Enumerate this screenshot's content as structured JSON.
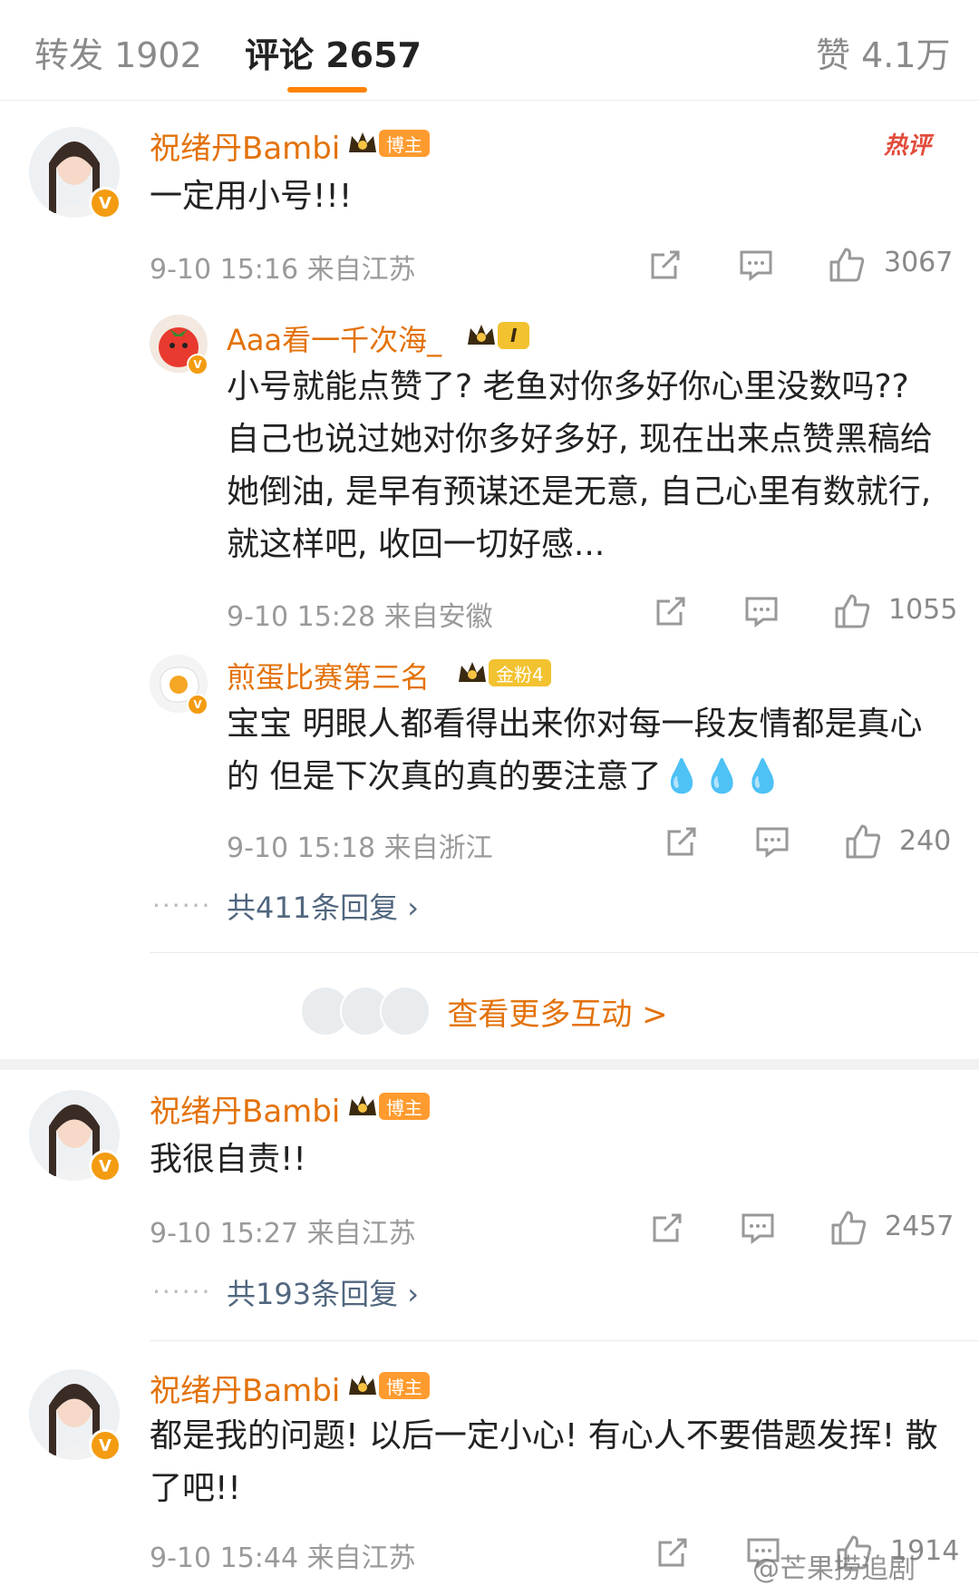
{
  "tabs": {
    "repost": "转发 1902",
    "comments": "评论 2657",
    "likes": "赞 4.1万"
  },
  "comments": [
    {
      "name": "祝绪丹Bambi",
      "tag": "博主",
      "hot": "热评",
      "text": "一定用小号!!!",
      "time_loc": "9-10 15:16  来自江苏",
      "likes": "3067",
      "replies": [
        {
          "name": "Aaa看一千次海_",
          "tag": "I",
          "text": "小号就能点赞了? 老鱼对你多好你心里没数吗?? 自己也说过她对你多好多好, 现在出来点赞黑稿给她倒油, 是早有预谋还是无意, 自己心里有数就行, 就这样吧, 收回一切好感...",
          "time_loc": "9-10 15:28  来自安徽",
          "likes": "1055"
        },
        {
          "name": "煎蛋比赛第三名",
          "tag": "金粉4",
          "text": "宝宝 明眼人都看得出来你对每一段友情都是真心的 但是下次真的真的要注意了💧💧💧",
          "time_loc": "9-10 15:18  来自浙江",
          "likes": "240"
        }
      ],
      "more_replies": "共411条回复 ›",
      "dots": "······"
    },
    {
      "name": "祝绪丹Bambi",
      "tag": "博主",
      "text": "我很自责!!",
      "time_loc": "9-10 15:27  来自江苏",
      "likes": "2457",
      "more_replies": "共193条回复 ›",
      "dots": "······"
    },
    {
      "name": "祝绪丹Bambi",
      "tag": "博主",
      "text": "都是我的问题! 以后一定小心! 有心人不要借题发挥! 散了吧!!",
      "time_loc": "9-10 15:44  来自江苏",
      "likes": "1914"
    }
  ],
  "more_interactions": "查看更多互动 >",
  "watermark": "@芒果捞追剧",
  "colors": {
    "accent": "#ff8200",
    "username": "#e3720a",
    "link": "#51677f"
  }
}
